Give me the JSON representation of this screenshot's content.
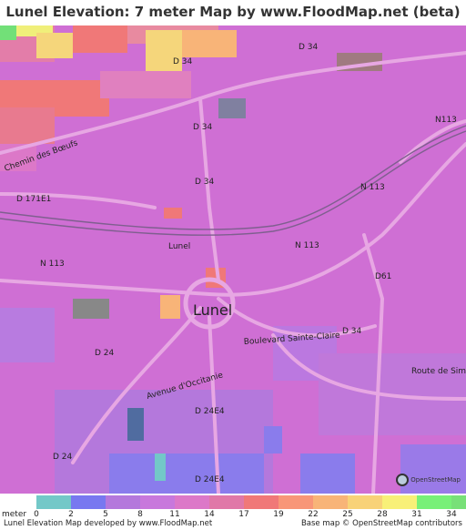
{
  "title": "Lunel Elevation: 7 meter Map by www.FloodMap.net (beta)",
  "map": {
    "town_label": "Lunel",
    "small_label": "Lunel",
    "road_labels": {
      "d34_top_right": "D 34",
      "d34_top": "D 34",
      "d34_mid": "D 34",
      "d34_center": "D 34",
      "d34_east": "D 34",
      "n113_northeast": "N113",
      "n113_east": "N 113",
      "n113_center": "N 113",
      "n113_west": "N 113",
      "d61": "D61",
      "d171e1": "D 171E1",
      "d24_west": "D 24",
      "d24_south": "D 24",
      "d24e4_mid": "D 24E4",
      "d24e4_south": "D 24E4",
      "chemin": "Chemin des Bœufs",
      "boulevard": "Boulevard Sainte-Claire",
      "avenue": "Avenue d'Occitanie",
      "route": "Route de Simiac"
    },
    "osm_logo_text": "OpenStreetMap"
  },
  "legend": {
    "unit_label": "meter",
    "ticks": [
      "0",
      "2",
      "5",
      "8",
      "11",
      "14",
      "17",
      "19",
      "22",
      "25",
      "28",
      "31",
      "34"
    ],
    "colors": [
      "#73c8c8",
      "#7878f0",
      "#b478dc",
      "#c878dc",
      "#dc78c8",
      "#e078a8",
      "#f07878",
      "#f89678",
      "#f8b478",
      "#f8d278",
      "#f8f078",
      "#78f078",
      "#78e078"
    ]
  },
  "footer": {
    "left": "Lunel Elevation Map developed by www.FloodMap.net",
    "right": "Base map © OpenStreetMap contributors"
  }
}
